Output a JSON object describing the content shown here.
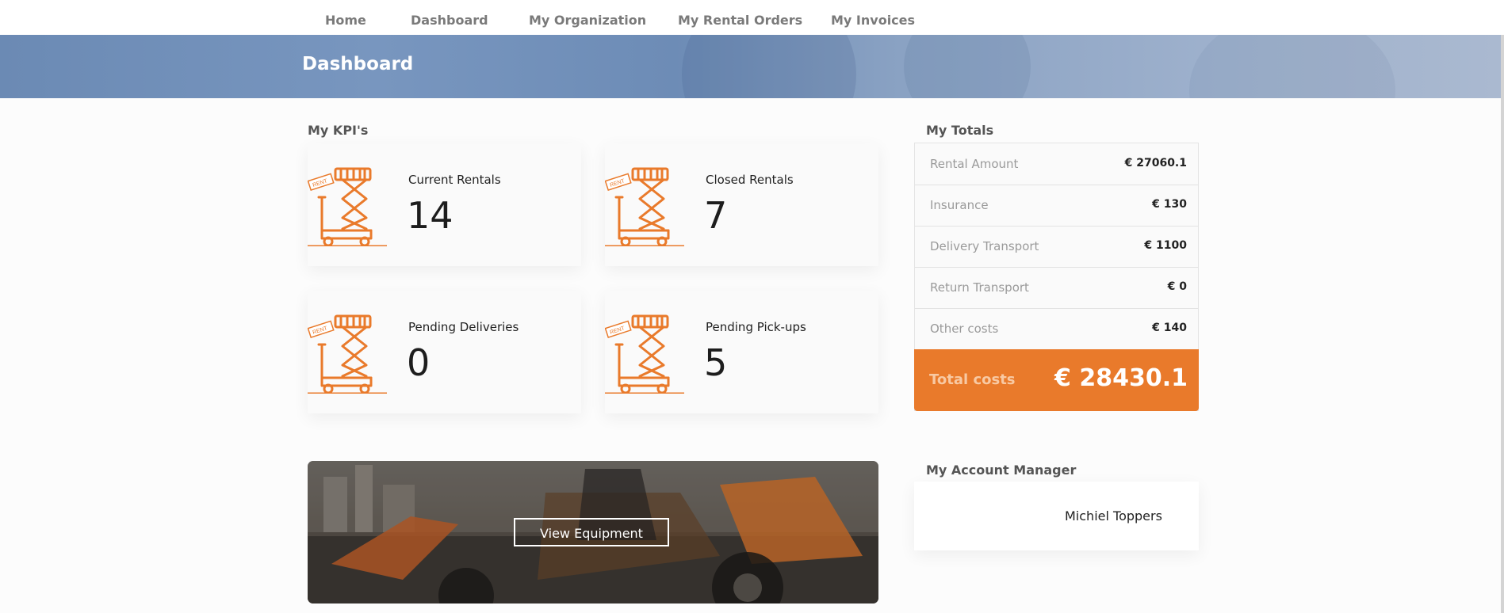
{
  "nav": {
    "items": [
      {
        "label": "Home"
      },
      {
        "label": "Dashboard"
      },
      {
        "label": "My Organization"
      },
      {
        "label": "My Rental Orders"
      },
      {
        "label": "My Invoices"
      }
    ]
  },
  "header": {
    "title": "Dashboard"
  },
  "kpis": {
    "title": "My KPI's",
    "cards": [
      {
        "label": "Current Rentals",
        "value": "14",
        "icon": "scissor-lift-icon",
        "badge": "RENT"
      },
      {
        "label": "Closed Rentals",
        "value": "7",
        "icon": "scissor-lift-icon",
        "badge": "RENT"
      },
      {
        "label": "Pending Deliveries",
        "value": "0",
        "icon": "scissor-lift-icon",
        "badge": "RENT"
      },
      {
        "label": "Pending Pick-ups",
        "value": "5",
        "icon": "scissor-lift-icon",
        "badge": "RENT"
      }
    ]
  },
  "totals": {
    "title": "My Totals",
    "rows": [
      {
        "label": "Rental Amount",
        "value": "€ 27060.1"
      },
      {
        "label": "Insurance",
        "value": "€ 130"
      },
      {
        "label": "Delivery Transport",
        "value": "€ 1100"
      },
      {
        "label": "Return Transport",
        "value": "€ 0"
      },
      {
        "label": "Other costs",
        "value": "€ 140"
      }
    ],
    "total_label": "Total costs",
    "total_value": "€ 28430.1"
  },
  "equipment": {
    "button_label": "View Equipment"
  },
  "manager": {
    "title": "My Account Manager",
    "name": "Michiel Toppers"
  },
  "colors": {
    "accent": "#e97a2b",
    "header_bg": "#7896bf"
  }
}
